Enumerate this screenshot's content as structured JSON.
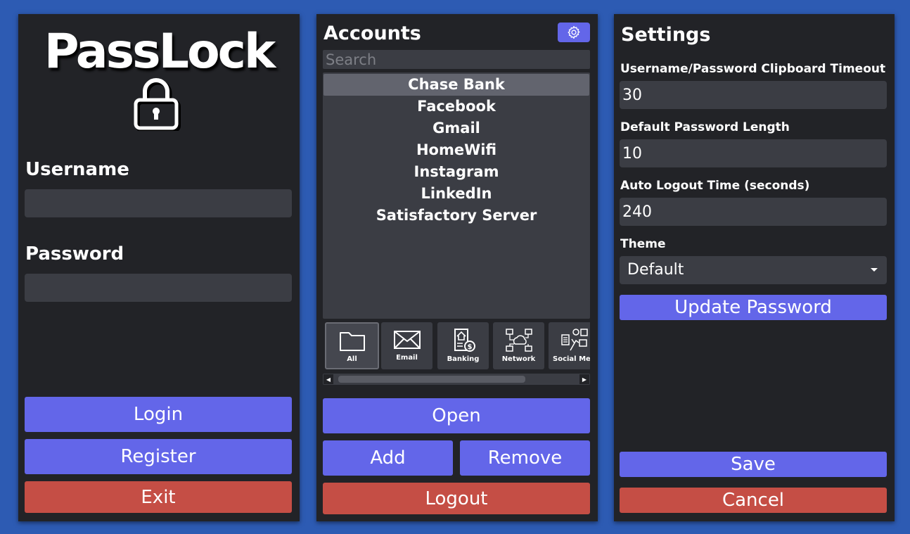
{
  "login": {
    "app_name": "PassLock",
    "username_label": "Username",
    "username_value": "",
    "password_label": "Password",
    "password_value": "",
    "login_label": "Login",
    "register_label": "Register",
    "exit_label": "Exit"
  },
  "accounts": {
    "title": "Accounts",
    "search_placeholder": "Search",
    "items": [
      {
        "label": "Chase Bank",
        "selected": true
      },
      {
        "label": "Facebook"
      },
      {
        "label": "Gmail"
      },
      {
        "label": "HomeWifi"
      },
      {
        "label": "Instagram"
      },
      {
        "label": "LinkedIn"
      },
      {
        "label": "Satisfactory Server"
      }
    ],
    "categories": [
      {
        "label": "All",
        "icon": "folder-icon",
        "selected": true
      },
      {
        "label": "Email",
        "icon": "envelope-icon"
      },
      {
        "label": "Banking",
        "icon": "banking-icon"
      },
      {
        "label": "Network",
        "icon": "network-icon"
      },
      {
        "label": "Social Med",
        "icon": "social-media-icon"
      }
    ],
    "open_label": "Open",
    "add_label": "Add",
    "remove_label": "Remove",
    "logout_label": "Logout"
  },
  "settings": {
    "title": "Settings",
    "clipboard_timeout_label": "Username/Password Clipboard Timeout",
    "clipboard_timeout_value": "30",
    "password_length_label": "Default Password Length",
    "password_length_value": "10",
    "auto_logout_label": "Auto Logout Time (seconds)",
    "auto_logout_value": "240",
    "theme_label": "Theme",
    "theme_value": "Default",
    "update_password_label": "Update Password",
    "save_label": "Save",
    "cancel_label": "Cancel"
  },
  "colors": {
    "background": "#2d5bb3",
    "panel": "#222327",
    "input": "#3b3d44",
    "accent_blue": "#6366e9",
    "danger_red": "#c54e45"
  }
}
